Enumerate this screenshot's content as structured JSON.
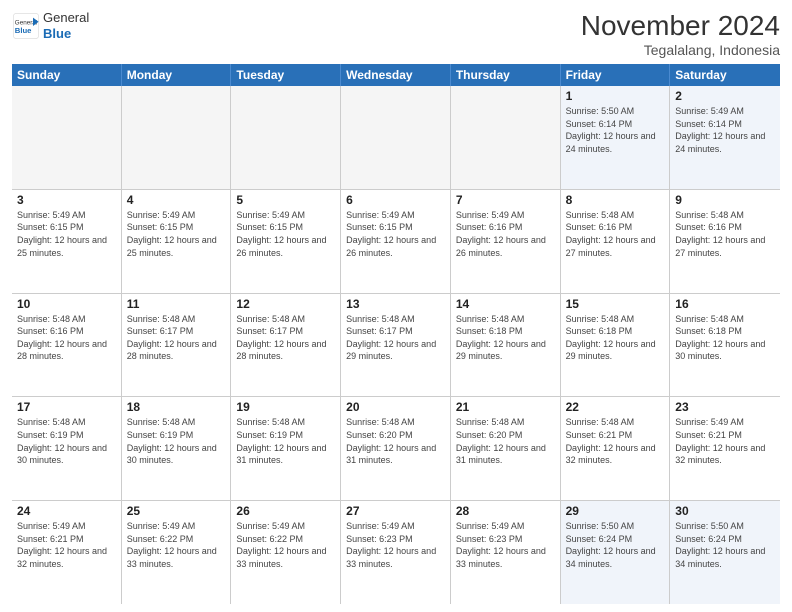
{
  "logo": {
    "general": "General",
    "blue": "Blue"
  },
  "title": "November 2024",
  "location": "Tegalalang, Indonesia",
  "days": [
    "Sunday",
    "Monday",
    "Tuesday",
    "Wednesday",
    "Thursday",
    "Friday",
    "Saturday"
  ],
  "weeks": [
    [
      {
        "day": "",
        "info": ""
      },
      {
        "day": "",
        "info": ""
      },
      {
        "day": "",
        "info": ""
      },
      {
        "day": "",
        "info": ""
      },
      {
        "day": "",
        "info": ""
      },
      {
        "day": "1",
        "info": "Sunrise: 5:50 AM\nSunset: 6:14 PM\nDaylight: 12 hours and 24 minutes."
      },
      {
        "day": "2",
        "info": "Sunrise: 5:49 AM\nSunset: 6:14 PM\nDaylight: 12 hours and 24 minutes."
      }
    ],
    [
      {
        "day": "3",
        "info": "Sunrise: 5:49 AM\nSunset: 6:15 PM\nDaylight: 12 hours and 25 minutes."
      },
      {
        "day": "4",
        "info": "Sunrise: 5:49 AM\nSunset: 6:15 PM\nDaylight: 12 hours and 25 minutes."
      },
      {
        "day": "5",
        "info": "Sunrise: 5:49 AM\nSunset: 6:15 PM\nDaylight: 12 hours and 26 minutes."
      },
      {
        "day": "6",
        "info": "Sunrise: 5:49 AM\nSunset: 6:15 PM\nDaylight: 12 hours and 26 minutes."
      },
      {
        "day": "7",
        "info": "Sunrise: 5:49 AM\nSunset: 6:16 PM\nDaylight: 12 hours and 26 minutes."
      },
      {
        "day": "8",
        "info": "Sunrise: 5:48 AM\nSunset: 6:16 PM\nDaylight: 12 hours and 27 minutes."
      },
      {
        "day": "9",
        "info": "Sunrise: 5:48 AM\nSunset: 6:16 PM\nDaylight: 12 hours and 27 minutes."
      }
    ],
    [
      {
        "day": "10",
        "info": "Sunrise: 5:48 AM\nSunset: 6:16 PM\nDaylight: 12 hours and 28 minutes."
      },
      {
        "day": "11",
        "info": "Sunrise: 5:48 AM\nSunset: 6:17 PM\nDaylight: 12 hours and 28 minutes."
      },
      {
        "day": "12",
        "info": "Sunrise: 5:48 AM\nSunset: 6:17 PM\nDaylight: 12 hours and 28 minutes."
      },
      {
        "day": "13",
        "info": "Sunrise: 5:48 AM\nSunset: 6:17 PM\nDaylight: 12 hours and 29 minutes."
      },
      {
        "day": "14",
        "info": "Sunrise: 5:48 AM\nSunset: 6:18 PM\nDaylight: 12 hours and 29 minutes."
      },
      {
        "day": "15",
        "info": "Sunrise: 5:48 AM\nSunset: 6:18 PM\nDaylight: 12 hours and 29 minutes."
      },
      {
        "day": "16",
        "info": "Sunrise: 5:48 AM\nSunset: 6:18 PM\nDaylight: 12 hours and 30 minutes."
      }
    ],
    [
      {
        "day": "17",
        "info": "Sunrise: 5:48 AM\nSunset: 6:19 PM\nDaylight: 12 hours and 30 minutes."
      },
      {
        "day": "18",
        "info": "Sunrise: 5:48 AM\nSunset: 6:19 PM\nDaylight: 12 hours and 30 minutes."
      },
      {
        "day": "19",
        "info": "Sunrise: 5:48 AM\nSunset: 6:19 PM\nDaylight: 12 hours and 31 minutes."
      },
      {
        "day": "20",
        "info": "Sunrise: 5:48 AM\nSunset: 6:20 PM\nDaylight: 12 hours and 31 minutes."
      },
      {
        "day": "21",
        "info": "Sunrise: 5:48 AM\nSunset: 6:20 PM\nDaylight: 12 hours and 31 minutes."
      },
      {
        "day": "22",
        "info": "Sunrise: 5:48 AM\nSunset: 6:21 PM\nDaylight: 12 hours and 32 minutes."
      },
      {
        "day": "23",
        "info": "Sunrise: 5:49 AM\nSunset: 6:21 PM\nDaylight: 12 hours and 32 minutes."
      }
    ],
    [
      {
        "day": "24",
        "info": "Sunrise: 5:49 AM\nSunset: 6:21 PM\nDaylight: 12 hours and 32 minutes."
      },
      {
        "day": "25",
        "info": "Sunrise: 5:49 AM\nSunset: 6:22 PM\nDaylight: 12 hours and 33 minutes."
      },
      {
        "day": "26",
        "info": "Sunrise: 5:49 AM\nSunset: 6:22 PM\nDaylight: 12 hours and 33 minutes."
      },
      {
        "day": "27",
        "info": "Sunrise: 5:49 AM\nSunset: 6:23 PM\nDaylight: 12 hours and 33 minutes."
      },
      {
        "day": "28",
        "info": "Sunrise: 5:49 AM\nSunset: 6:23 PM\nDaylight: 12 hours and 33 minutes."
      },
      {
        "day": "29",
        "info": "Sunrise: 5:50 AM\nSunset: 6:24 PM\nDaylight: 12 hours and 34 minutes."
      },
      {
        "day": "30",
        "info": "Sunrise: 5:50 AM\nSunset: 6:24 PM\nDaylight: 12 hours and 34 minutes."
      }
    ]
  ]
}
